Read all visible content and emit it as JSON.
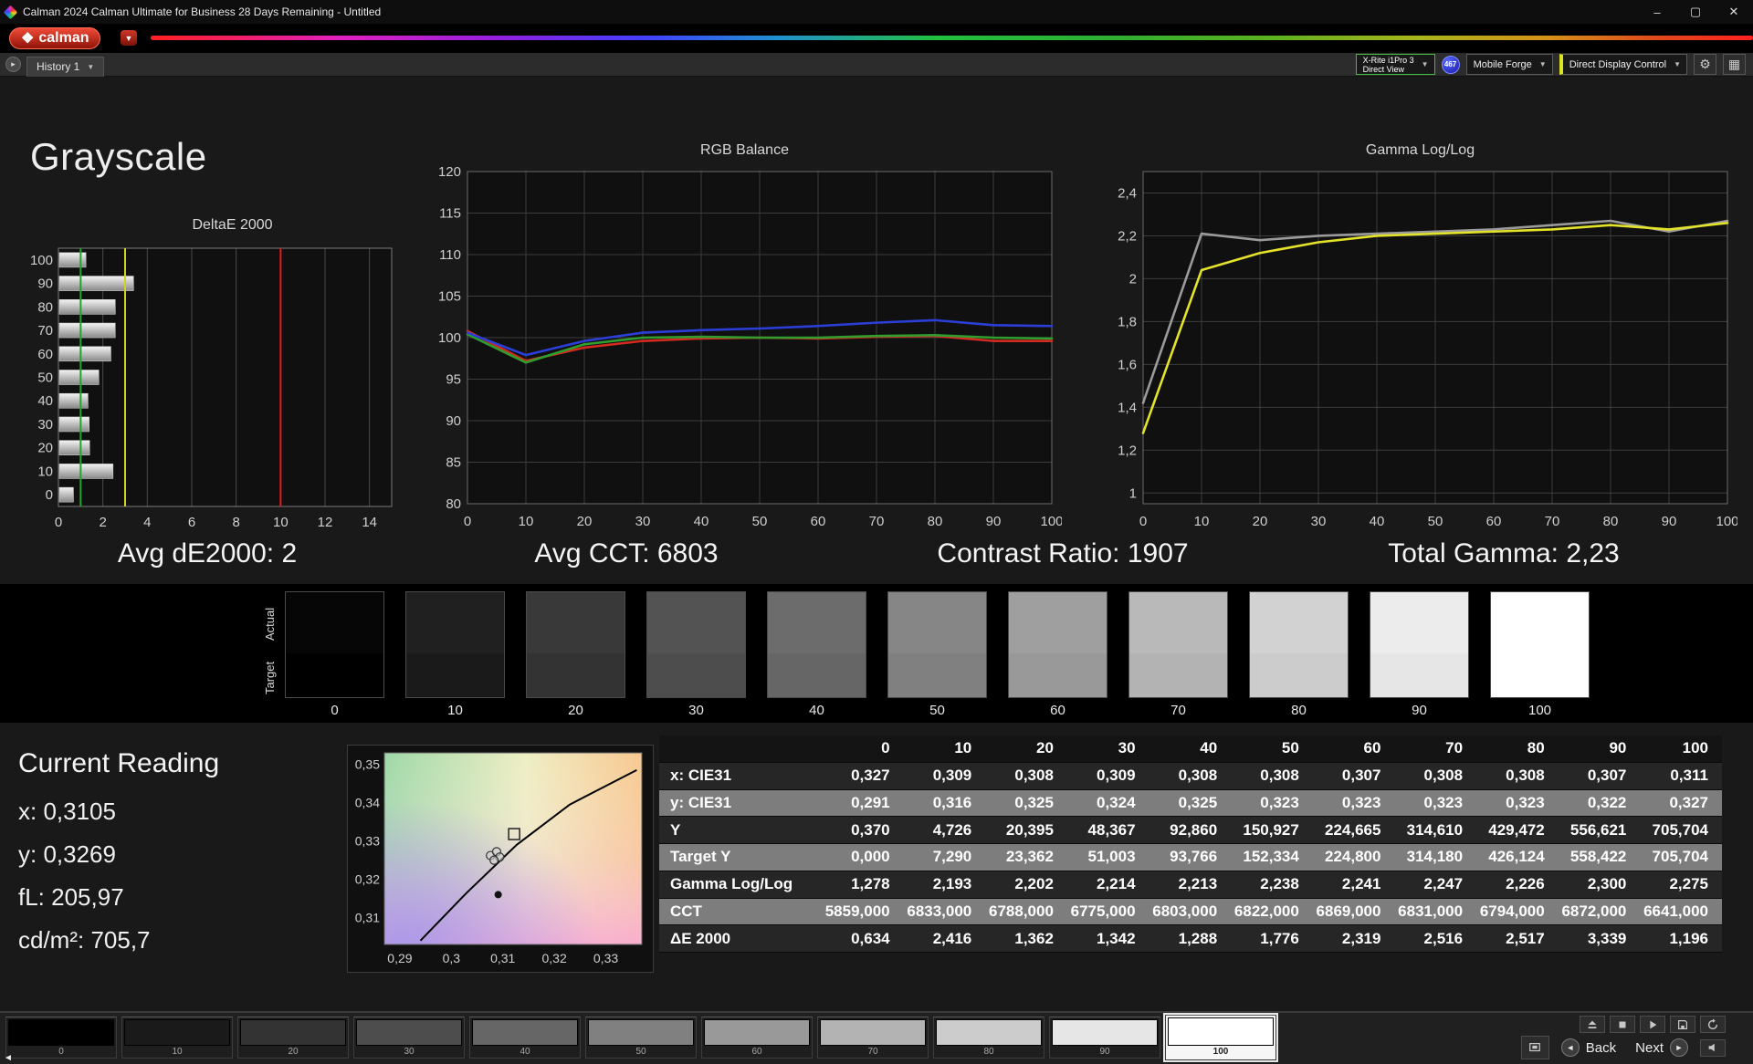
{
  "window": {
    "title": "Calman 2024 Calman Ultimate for Business 28 Days Remaining - Untitled"
  },
  "brand": {
    "logo_text": "calman"
  },
  "tabs": {
    "history_label": "History 1"
  },
  "devices": {
    "meter_line1": "X-Rite i1Pro 3",
    "meter_line2": "Direct View",
    "badge": "467",
    "source": "Mobile Forge",
    "display_control": "Direct Display Control"
  },
  "page": {
    "title": "Grayscale"
  },
  "stats": [
    "Avg dE2000: 2",
    "Avg CCT: 6803",
    "Contrast Ratio: 1907",
    "Total Gamma: 2,23"
  ],
  "current_reading": {
    "title": "Current Reading",
    "lines": [
      "x: 0,3105",
      "y: 0,3269",
      "fL: 205,97",
      "cd/m²: 705,7"
    ]
  },
  "swatch_strip": {
    "actual_label": "Actual",
    "target_label": "Target",
    "levels": [
      "0",
      "10",
      "20",
      "30",
      "40",
      "50",
      "60",
      "70",
      "80",
      "90",
      "100"
    ]
  },
  "table": {
    "columns": [
      "0",
      "10",
      "20",
      "30",
      "40",
      "50",
      "60",
      "70",
      "80",
      "90",
      "100"
    ],
    "rows": [
      {
        "label": "x: CIE31",
        "values": [
          "0,327",
          "0,309",
          "0,308",
          "0,309",
          "0,308",
          "0,308",
          "0,307",
          "0,308",
          "0,308",
          "0,307",
          "0,311"
        ]
      },
      {
        "label": "y: CIE31",
        "values": [
          "0,291",
          "0,316",
          "0,325",
          "0,324",
          "0,325",
          "0,323",
          "0,323",
          "0,323",
          "0,323",
          "0,322",
          "0,327"
        ]
      },
      {
        "label": "Y",
        "values": [
          "0,370",
          "4,726",
          "20,395",
          "48,367",
          "92,860",
          "150,927",
          "224,665",
          "314,610",
          "429,472",
          "556,621",
          "705,704"
        ]
      },
      {
        "label": "Target Y",
        "values": [
          "0,000",
          "7,290",
          "23,362",
          "51,003",
          "93,766",
          "152,334",
          "224,800",
          "314,180",
          "426,124",
          "558,422",
          "705,704"
        ]
      },
      {
        "label": "Gamma Log/Log",
        "values": [
          "1,278",
          "2,193",
          "2,202",
          "2,214",
          "2,213",
          "2,238",
          "2,241",
          "2,247",
          "2,226",
          "2,300",
          "2,275"
        ]
      },
      {
        "label": "CCT",
        "values": [
          "5859,000",
          "6833,000",
          "6788,000",
          "6775,000",
          "6803,000",
          "6822,000",
          "6869,000",
          "6831,000",
          "6794,000",
          "6872,000",
          "6641,000"
        ]
      },
      {
        "label": "ΔE 2000",
        "values": [
          "0,634",
          "2,416",
          "1,362",
          "1,342",
          "1,288",
          "1,776",
          "2,319",
          "2,516",
          "2,517",
          "3,339",
          "1,196"
        ]
      }
    ]
  },
  "chart_data": [
    {
      "id": "deltae",
      "type": "bar",
      "orientation": "horizontal",
      "title": "DeltaE 2000",
      "categories": [
        0,
        10,
        20,
        30,
        40,
        50,
        60,
        70,
        80,
        90,
        100
      ],
      "values": [
        0.634,
        2.416,
        1.362,
        1.342,
        1.288,
        1.776,
        2.319,
        2.516,
        2.517,
        3.339,
        1.196
      ],
      "xlim": [
        0,
        15
      ],
      "xticks": [
        0,
        2,
        4,
        6,
        8,
        10,
        12,
        14
      ],
      "thresholds": [
        {
          "value": 1,
          "color": "#22a52a"
        },
        {
          "value": 3,
          "color": "#cfd41f"
        },
        {
          "value": 10,
          "color": "#e31b1b"
        }
      ]
    },
    {
      "id": "rgb_balance",
      "type": "line",
      "title": "RGB Balance",
      "x": [
        0,
        10,
        20,
        30,
        40,
        50,
        60,
        70,
        80,
        90,
        100
      ],
      "xlim": [
        0,
        100
      ],
      "xticks": [
        0,
        10,
        20,
        30,
        40,
        50,
        60,
        70,
        80,
        90,
        100
      ],
      "ylim": [
        80,
        120
      ],
      "yticks": [
        80,
        85,
        90,
        95,
        100,
        105,
        110,
        115,
        120
      ],
      "series": [
        {
          "name": "Red",
          "color": "#d42a20",
          "values": [
            100.8,
            97.2,
            98.8,
            99.6,
            99.9,
            100.0,
            99.9,
            100.1,
            100.2,
            99.6,
            99.6
          ]
        },
        {
          "name": "Green",
          "color": "#2f9e2f",
          "values": [
            100.4,
            97.0,
            99.2,
            100.0,
            100.1,
            100.0,
            100.0,
            100.2,
            100.3,
            100.0,
            99.9
          ]
        },
        {
          "name": "Blue",
          "color": "#2b3fd8",
          "values": [
            100.6,
            97.9,
            99.6,
            100.6,
            100.9,
            101.1,
            101.4,
            101.8,
            102.1,
            101.5,
            101.4
          ]
        }
      ]
    },
    {
      "id": "gamma",
      "type": "line",
      "title": "Gamma Log/Log",
      "x": [
        0,
        10,
        20,
        30,
        40,
        50,
        60,
        70,
        80,
        90,
        100
      ],
      "xlim": [
        0,
        100
      ],
      "xticks": [
        0,
        10,
        20,
        30,
        40,
        50,
        60,
        70,
        80,
        90,
        100
      ],
      "ylim": [
        0.95,
        2.5
      ],
      "yticks": [
        1,
        1.2,
        1.4,
        1.6,
        1.8,
        2,
        2.2,
        2.4
      ],
      "decimal_comma": true,
      "series": [
        {
          "name": "Target",
          "color": "#9b9b9b",
          "values": [
            1.42,
            2.21,
            2.18,
            2.2,
            2.21,
            2.22,
            2.23,
            2.25,
            2.27,
            2.22,
            2.27
          ]
        },
        {
          "name": "Measured",
          "color": "#e3e32a",
          "values": [
            1.28,
            2.04,
            2.12,
            2.17,
            2.2,
            2.21,
            2.22,
            2.23,
            2.25,
            2.23,
            2.26
          ]
        }
      ]
    },
    {
      "id": "cie",
      "type": "scatter",
      "title": "",
      "xlim": [
        0.287,
        0.337
      ],
      "ylim": [
        0.303,
        0.353
      ],
      "xticks": [
        0.29,
        0.3,
        0.31,
        0.32,
        0.33
      ],
      "yticks": [
        0.31,
        0.32,
        0.33,
        0.34,
        0.35
      ],
      "decimal_comma": true,
      "locus": [
        [
          0.294,
          0.304
        ],
        [
          0.303,
          0.3165
        ],
        [
          0.3127,
          0.329
        ],
        [
          0.323,
          0.3395
        ],
        [
          0.336,
          0.3485
        ]
      ],
      "target_square": {
        "x": 0.3122,
        "y": 0.3318
      },
      "points": [
        {
          "x": 0.3076,
          "y": 0.3262
        },
        {
          "x": 0.3088,
          "y": 0.3272
        },
        {
          "x": 0.3094,
          "y": 0.3258
        },
        {
          "x": 0.3083,
          "y": 0.325
        }
      ],
      "dot": {
        "x": 0.3091,
        "y": 0.316
      }
    }
  ],
  "bottom_bar": {
    "levels": [
      "0",
      "10",
      "20",
      "30",
      "40",
      "50",
      "60",
      "70",
      "80",
      "90",
      "100"
    ],
    "selected": "100",
    "back_label": "Back",
    "next_label": "Next"
  }
}
